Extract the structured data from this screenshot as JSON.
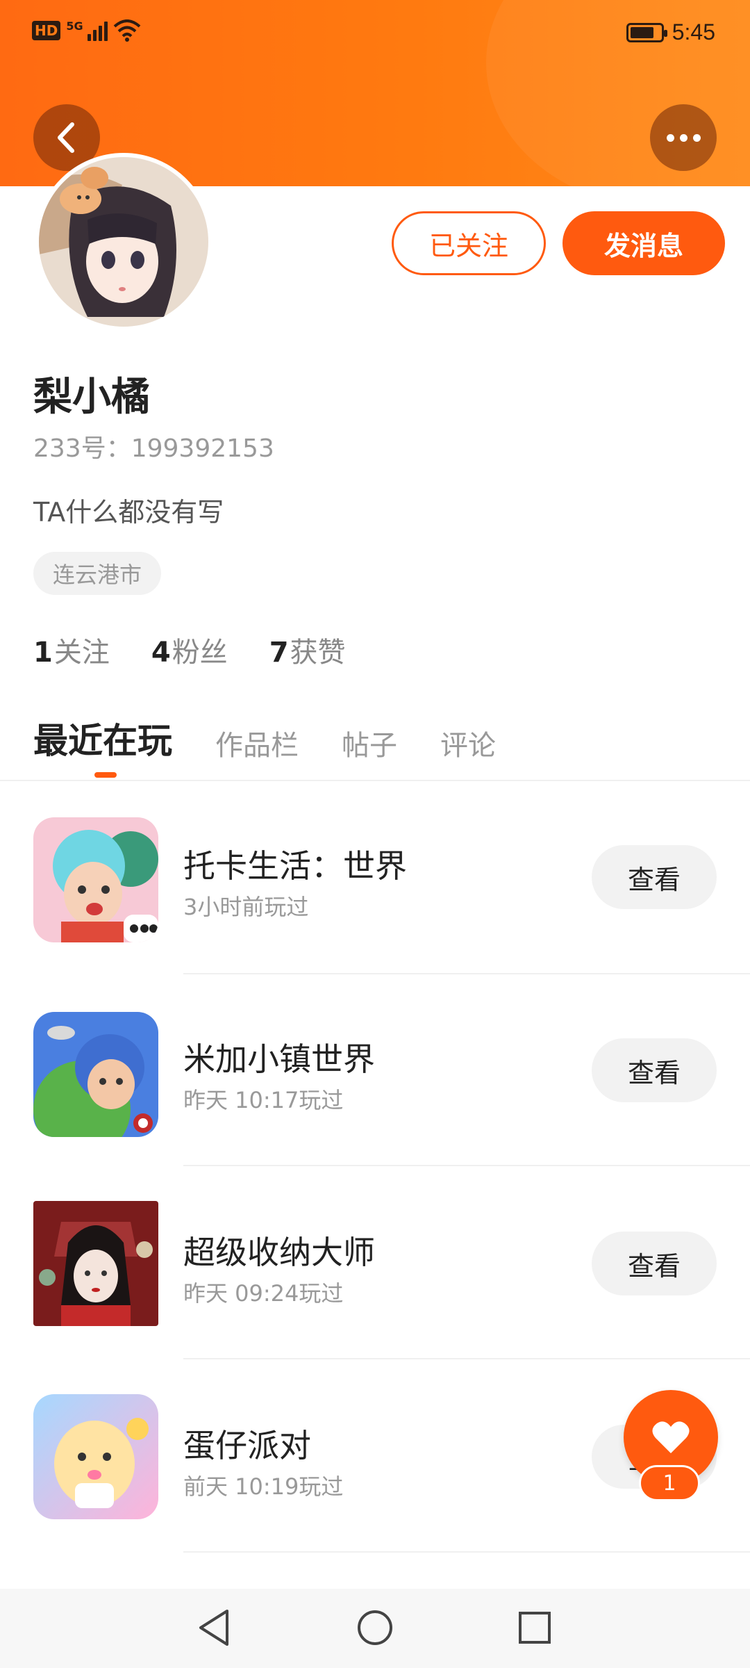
{
  "status_bar": {
    "hd": "HD",
    "network": "5G",
    "time": "5:45"
  },
  "header": {
    "back_icon": "chevron-left-icon",
    "more_icon": "more-dots-icon"
  },
  "profile": {
    "name": "梨小橘",
    "id_text": "233号：199392153",
    "bio": "TA什么都没有写",
    "location": "连云港市",
    "follow_label": "已关注",
    "message_label": "发消息",
    "stats": [
      {
        "count": "1",
        "label": "关注"
      },
      {
        "count": "4",
        "label": "粉丝"
      },
      {
        "count": "7",
        "label": "获赞"
      }
    ]
  },
  "tabs": [
    {
      "label": "最近在玩",
      "active": true
    },
    {
      "label": "作品栏",
      "active": false
    },
    {
      "label": "帖子",
      "active": false
    },
    {
      "label": "评论",
      "active": false
    }
  ],
  "games": [
    {
      "name": "托卡生活：世界",
      "time": "3小时前玩过",
      "button": "查看"
    },
    {
      "name": "米加小镇世界",
      "time": "昨天 10:17玩过",
      "button": "查看"
    },
    {
      "name": "超级收纳大师",
      "time": "昨天 09:24玩过",
      "button": "查看"
    },
    {
      "name": "蛋仔派对",
      "time": "前天 10:19玩过",
      "button": "查看"
    }
  ],
  "like_fab": {
    "icon": "heart-icon",
    "count": "1"
  },
  "colors": {
    "accent": "#ff5a0f",
    "header": "#ff7a10"
  },
  "nav": {
    "back": "triangle-back-icon",
    "home": "circle-home-icon",
    "recents": "square-recents-icon"
  }
}
